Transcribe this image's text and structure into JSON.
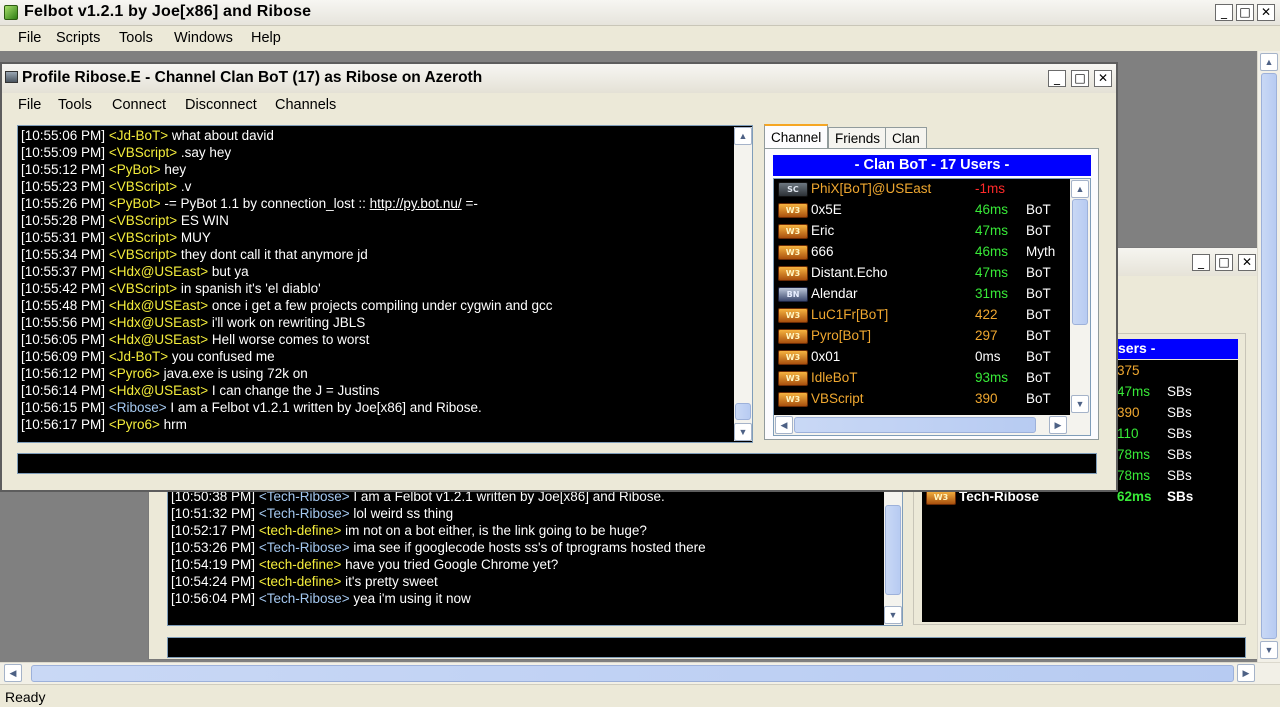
{
  "app": {
    "title": "Felbot v1.2.1 by Joe[x86] and Ribose",
    "menu": [
      "File",
      "Scripts",
      "Tools",
      "Windows",
      "Help"
    ],
    "status": "Ready"
  },
  "window_buttons": {
    "minimize": "_",
    "maximize": "□",
    "close": "✕"
  },
  "profile_window": {
    "title": "Profile Ribose.E - Channel Clan BoT (17) as Ribose on Azeroth",
    "menu": [
      "File",
      "Tools",
      "Connect",
      "Disconnect",
      "Channels"
    ],
    "tabs": [
      "Channel",
      "Friends",
      "Clan"
    ],
    "active_tab": "Channel",
    "users_header": "- Clan BoT - 17 Users -",
    "chat": [
      {
        "ts": "[10:55:06 PM]",
        "nick": "<Jd-BoT>",
        "nick_color": "yellow",
        "msg": " what about david"
      },
      {
        "ts": "[10:55:09 PM]",
        "nick": "<VBScript>",
        "nick_color": "yellow",
        "msg": " .say hey"
      },
      {
        "ts": "[10:55:12 PM]",
        "nick": "<PyBot>",
        "nick_color": "yellow",
        "msg": "  hey"
      },
      {
        "ts": "[10:55:23 PM]",
        "nick": "<VBScript>",
        "nick_color": "yellow",
        "msg": " .v"
      },
      {
        "ts": "[10:55:26 PM]",
        "nick": "<PyBot>",
        "nick_color": "yellow",
        "msg": "  -= PyBot 1.1 by connection_lost :: ",
        "link": "http://py.bot.nu/",
        "msg_after": " =-"
      },
      {
        "ts": "[10:55:28 PM]",
        "nick": "<VBScript>",
        "nick_color": "yellow",
        "msg": " ES WIN"
      },
      {
        "ts": "[10:55:31 PM]",
        "nick": "<VBScript>",
        "nick_color": "yellow",
        "msg": " MUY"
      },
      {
        "ts": "[10:55:34 PM]",
        "nick": "<VBScript>",
        "nick_color": "yellow",
        "msg": " they dont call it that anymore jd"
      },
      {
        "ts": "[10:55:37 PM]",
        "nick": "<Hdx@USEast>",
        "nick_color": "yellow",
        "msg": " but ya"
      },
      {
        "ts": "[10:55:42 PM]",
        "nick": "<VBScript>",
        "nick_color": "yellow",
        "msg": " in spanish it's 'el diablo'"
      },
      {
        "ts": "[10:55:48 PM]",
        "nick": "<Hdx@USEast>",
        "nick_color": "yellow",
        "msg": " once i get a few projects compiling under cygwin and gcc"
      },
      {
        "ts": "[10:55:56 PM]",
        "nick": "<Hdx@USEast>",
        "nick_color": "yellow",
        "msg": " i'll work on rewriting JBLS"
      },
      {
        "ts": "[10:56:05 PM]",
        "nick": "<Hdx@USEast>",
        "nick_color": "yellow",
        "msg": " Hell worse comes to worst"
      },
      {
        "ts": "[10:56:09 PM]",
        "nick": "<Jd-BoT>",
        "nick_color": "yellow",
        "msg": " you confused me"
      },
      {
        "ts": "[10:56:12 PM]",
        "nick": "<Pyro6>",
        "nick_color": "yellow",
        "msg": " java.exe is using 72k on"
      },
      {
        "ts": "[10:56:14 PM]",
        "nick": "<Hdx@USEast>",
        "nick_color": "yellow",
        "msg": " I can change the J = Justins"
      },
      {
        "ts": "[10:56:15 PM]",
        "nick": "<Ribose>",
        "nick_color": "blue",
        "msg": " I am a Felbot v1.2.1 written by Joe[x86] and Ribose."
      },
      {
        "ts": "[10:56:17 PM]",
        "nick": "<Pyro6>",
        "nick_color": "yellow",
        "msg": " hrm"
      }
    ],
    "users": [
      {
        "icon": "starcraft-icon",
        "icon_text": "SC",
        "name": "PhiX[BoT]@USEast",
        "name_color": "orange",
        "ping": "-1ms",
        "ping_color": "red",
        "client": ""
      },
      {
        "icon": "warcraft3-icon",
        "icon_text": "W3",
        "name": "0x5E",
        "name_color": "white",
        "ping": "46ms",
        "ping_color": "green",
        "client": "BoT"
      },
      {
        "icon": "warcraft3-icon",
        "icon_text": "W3",
        "name": "Eric",
        "name_color": "white",
        "ping": "47ms",
        "ping_color": "green",
        "client": "BoT"
      },
      {
        "icon": "warcraft3-icon",
        "icon_text": "W3",
        "name": "666",
        "name_color": "white",
        "ping": "46ms",
        "ping_color": "green",
        "client": "Myth"
      },
      {
        "icon": "warcraft3-icon",
        "icon_text": "W3",
        "name": "Distant.Echo",
        "name_color": "white",
        "ping": "47ms",
        "ping_color": "green",
        "client": "BoT"
      },
      {
        "icon": "battlenet-icon",
        "icon_text": "BN",
        "name": "Alendar",
        "name_color": "white",
        "ping": "31ms",
        "ping_color": "green",
        "client": "BoT"
      },
      {
        "icon": "warcraft3-icon",
        "icon_text": "W3",
        "name": "LuC1Fr[BoT]",
        "name_color": "orange",
        "ping": "422",
        "ping_color": "orange",
        "client": "BoT"
      },
      {
        "icon": "warcraft3-icon",
        "icon_text": "W3",
        "name": "Pyro[BoT]",
        "name_color": "orange",
        "ping": "297",
        "ping_color": "orange",
        "client": "BoT"
      },
      {
        "icon": "warcraft3-icon",
        "icon_text": "W3",
        "name": "0x01",
        "name_color": "white",
        "ping": "0ms",
        "ping_color": "white",
        "client": "BoT"
      },
      {
        "icon": "warcraft3-icon",
        "icon_text": "W3",
        "name": "IdleBoT",
        "name_color": "orange",
        "ping": "93ms",
        "ping_color": "green",
        "client": "BoT"
      },
      {
        "icon": "warcraft3-icon",
        "icon_text": "W3",
        "name": "VBScript",
        "name_color": "orange",
        "ping": "390",
        "ping_color": "orange",
        "client": "BoT"
      }
    ]
  },
  "background_window": {
    "users_header_fragment": "sers -",
    "chat": [
      {
        "ts": "[10:50:38 PM]",
        "nick": "<Tech-Ribose>",
        "nick_color": "blue",
        "msg": " I am a Felbot v1.2.1 written by Joe[x86] and Ribose."
      },
      {
        "ts": "[10:51:32 PM]",
        "nick": "<Tech-Ribose>",
        "nick_color": "blue",
        "msg": " lol weird ss thing"
      },
      {
        "ts": "[10:52:17 PM]",
        "nick": "<tech-define>",
        "nick_color": "yellow",
        "msg": " im not on a bot either, is the link going to be huge?"
      },
      {
        "ts": "[10:53:26 PM]",
        "nick": "<Tech-Ribose>",
        "nick_color": "blue",
        "msg": " ima see if googlecode hosts ss's of tprograms hosted there"
      },
      {
        "ts": "[10:54:19 PM]",
        "nick": "<tech-define>",
        "nick_color": "yellow",
        "msg": " have you tried Google Chrome yet?"
      },
      {
        "ts": "[10:54:24 PM]",
        "nick": "<tech-define>",
        "nick_color": "yellow",
        "msg": " it's pretty sweet"
      },
      {
        "ts": "[10:56:04 PM]",
        "nick": "<Tech-Ribose>",
        "nick_color": "blue",
        "msg": " yea i'm using it now"
      }
    ],
    "users": [
      {
        "ping": "375",
        "ping_color": "orange",
        "client": ""
      },
      {
        "ping": "47ms",
        "ping_color": "green",
        "client": "SBs"
      },
      {
        "ping": "390",
        "ping_color": "orange",
        "client": "SBs"
      },
      {
        "ping": "110",
        "ping_color": "green",
        "client": "SBs"
      },
      {
        "ping": "78ms",
        "ping_color": "green",
        "client": "SBs"
      },
      {
        "ping": "78ms",
        "ping_color": "green",
        "client": "SBs"
      }
    ],
    "self_user": {
      "name": "Tech-Ribose",
      "ping": "62ms",
      "client": "SBs"
    }
  },
  "colors": {
    "chat_bg": "#000000",
    "nick_yellow": "#f5ee3c",
    "nick_blue": "#a4c8f0",
    "header_blue": "#0000ff",
    "ping_green": "#38ea38",
    "ping_red": "#ff2a2a",
    "name_orange": "#f0a830"
  }
}
